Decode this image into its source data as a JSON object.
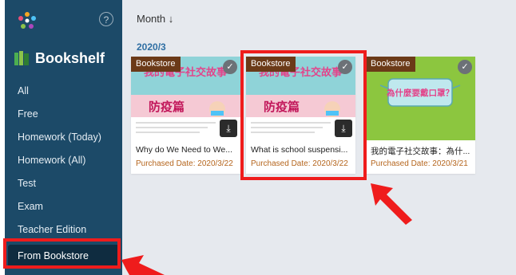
{
  "sidebar": {
    "title": "Bookshelf",
    "help_label": "?",
    "items": [
      {
        "label": "All"
      },
      {
        "label": "Free"
      },
      {
        "label": "Homework (Today)"
      },
      {
        "label": "Homework (All)"
      },
      {
        "label": "Test"
      },
      {
        "label": "Exam"
      },
      {
        "label": "Teacher Edition"
      },
      {
        "label": "From Bookstore",
        "active": true
      }
    ]
  },
  "main": {
    "sort_label": "Month ↓",
    "group_date": "2020/3",
    "books": [
      {
        "tag": "Bookstore",
        "title": "Why do We Need to We...",
        "date": "Purchased Date: 2020/3/22",
        "cover_text": "防疫篇",
        "cover_header": "我的電子社交故事",
        "downloadable": true
      },
      {
        "tag": "Bookstore",
        "title": "What is school suspensi...",
        "date": "Purchased Date: 2020/3/22",
        "cover_text": "防疫篇",
        "cover_header": "我的電子社交故事",
        "downloadable": true
      },
      {
        "tag": "Bookstore",
        "title": "我的電子社交故事：為什...",
        "date": "Purchased Date: 2020/3/21",
        "cover_text": "為什麼要戴口罩？",
        "downloadable": false
      }
    ]
  },
  "colors": {
    "sidebar_bg": "#1c4a68",
    "active_bg": "#0f2c40",
    "highlight": "#ef1c1c",
    "tag_bg": "#6b3a18",
    "date_text": "#b5651d",
    "group_date": "#2f6fa3"
  }
}
